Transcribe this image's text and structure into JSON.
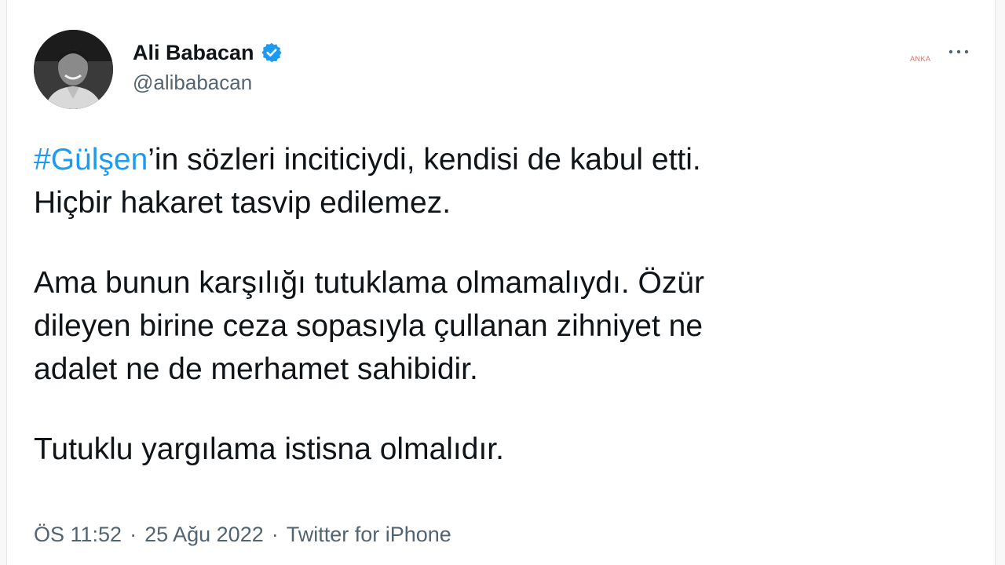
{
  "author": {
    "display_name": "Ali Babacan",
    "handle": "@alibabacan",
    "verified": true,
    "verified_color": "#1d9bf0"
  },
  "tweet": {
    "hashtag": "#Gülşen",
    "line1_rest": "’in sözleri inciticiydi, kendisi de kabul etti.",
    "line2": "Hiçbir hakaret tasvip edilemez.",
    "para2_line1": "Ama bunun karşılığı tutuklama olmamalıydı. Özür",
    "para2_line2": "dileyen birine ceza sopasıyla çullanan zihniyet ne",
    "para2_line3": "adalet ne de merhamet sahibidir.",
    "para3": "Tutuklu yargılama istisna olmalıdır."
  },
  "meta": {
    "time": "ÖS 11:52",
    "date": "25 Ağu 2022",
    "source": "Twitter for iPhone",
    "separator": "·"
  },
  "colors": {
    "link": "#1d9bf0",
    "text": "#0f1419",
    "secondary": "#536471"
  },
  "icons": {
    "more": "more-options-icon",
    "verified": "verified-badge-icon"
  }
}
